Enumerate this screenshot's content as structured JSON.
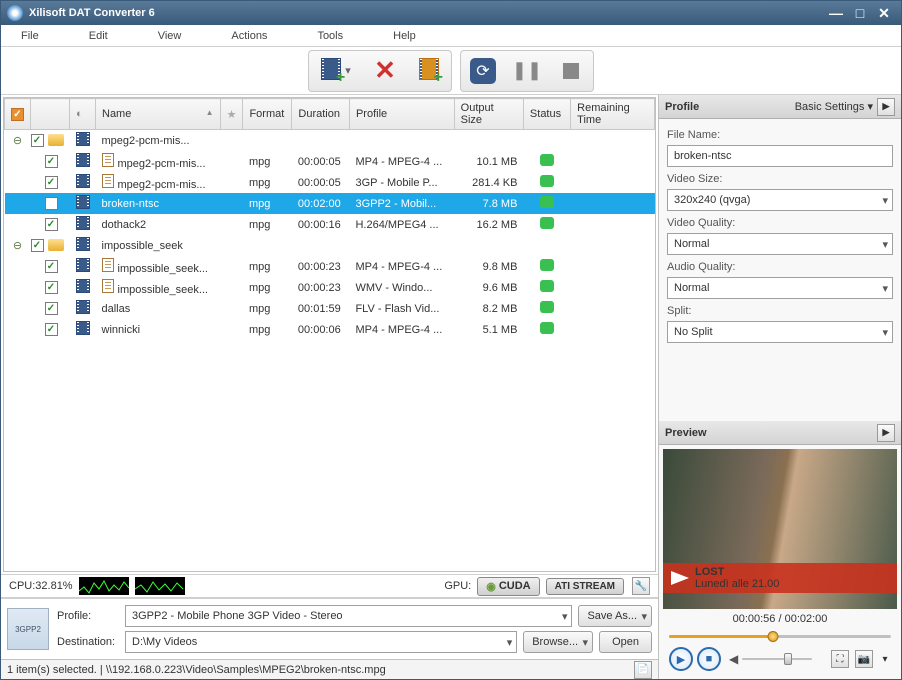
{
  "title": "Xilisoft DAT Converter 6",
  "menu": [
    "File",
    "Edit",
    "View",
    "Actions",
    "Tools",
    "Help"
  ],
  "columns": [
    "",
    "",
    "",
    "Name",
    "",
    "Format",
    "Duration",
    "Profile",
    "Output Size",
    "Status",
    "Remaining Time"
  ],
  "rows": [
    {
      "level": 0,
      "expand": "⊖",
      "check": true,
      "folder": true,
      "film": true,
      "doc": false,
      "name": "mpeg2-pcm-mis...",
      "fmt": "",
      "dur": "",
      "profile": "",
      "size": "",
      "status": false
    },
    {
      "level": 1,
      "check": true,
      "film": true,
      "doc": true,
      "name": "mpeg2-pcm-mis...",
      "fmt": "mpg",
      "dur": "00:00:05",
      "profile": "MP4 - MPEG-4 ...",
      "size": "10.1 MB",
      "status": true
    },
    {
      "level": 1,
      "check": true,
      "film": true,
      "doc": true,
      "name": "mpeg2-pcm-mis...",
      "fmt": "mpg",
      "dur": "00:00:05",
      "profile": "3GP - Mobile P...",
      "size": "281.4 KB",
      "status": true
    },
    {
      "level": 1,
      "check": true,
      "film": true,
      "doc": false,
      "name": "broken-ntsc",
      "fmt": "mpg",
      "dur": "00:02:00",
      "profile": "3GPP2 - Mobil...",
      "size": "7.8 MB",
      "status": true,
      "selected": true
    },
    {
      "level": 1,
      "check": true,
      "film": true,
      "doc": false,
      "name": "dothack2",
      "fmt": "mpg",
      "dur": "00:00:16",
      "profile": "H.264/MPEG4 ...",
      "size": "16.2 MB",
      "status": true
    },
    {
      "level": 0,
      "expand": "⊖",
      "check": true,
      "folder": true,
      "film": true,
      "doc": false,
      "name": "impossible_seek",
      "fmt": "",
      "dur": "",
      "profile": "",
      "size": "",
      "status": false
    },
    {
      "level": 1,
      "check": true,
      "film": true,
      "doc": true,
      "name": "impossible_seek...",
      "fmt": "mpg",
      "dur": "00:00:23",
      "profile": "MP4 - MPEG-4 ...",
      "size": "9.8 MB",
      "status": true
    },
    {
      "level": 1,
      "check": true,
      "film": true,
      "doc": true,
      "name": "impossible_seek...",
      "fmt": "mpg",
      "dur": "00:00:23",
      "profile": "WMV - Windo...",
      "size": "9.6 MB",
      "status": true
    },
    {
      "level": 1,
      "check": true,
      "film": true,
      "doc": false,
      "name": "dallas",
      "fmt": "mpg",
      "dur": "00:01:59",
      "profile": "FLV - Flash Vid...",
      "size": "8.2 MB",
      "status": true
    },
    {
      "level": 1,
      "check": true,
      "film": true,
      "doc": false,
      "name": "winnicki",
      "fmt": "mpg",
      "dur": "00:00:06",
      "profile": "MP4 - MPEG-4 ...",
      "size": "5.1 MB",
      "status": true
    }
  ],
  "cpu": {
    "label": "CPU:32.81%"
  },
  "gpu": {
    "label": "GPU:",
    "cuda": "CUDA",
    "ati": "ATI STREAM"
  },
  "bottom": {
    "profile_label": "Profile:",
    "profile_value": "3GPP2 - Mobile Phone 3GP Video - Stereo",
    "dest_label": "Destination:",
    "dest_value": "D:\\My Videos",
    "save_as": "Save As...",
    "browse": "Browse...",
    "open": "Open"
  },
  "status_text": "1 item(s) selected. | \\\\192.168.0.223\\Video\\Samples\\MPEG2\\broken-ntsc.mpg",
  "profile_panel": {
    "title": "Profile",
    "basic": "Basic Settings ▾",
    "filename_label": "File Name:",
    "filename": "broken-ntsc",
    "videosize_label": "Video Size:",
    "videosize": "320x240 (qvga)",
    "vq_label": "Video Quality:",
    "vq": "Normal",
    "aq_label": "Audio Quality:",
    "aq": "Normal",
    "split_label": "Split:",
    "split": "No Split"
  },
  "preview": {
    "title": "Preview",
    "banner_title": "LOST",
    "banner_sub": "Lunedì alle 21.00",
    "time": "00:00:56 / 00:02:00",
    "progress_pct": 47
  }
}
